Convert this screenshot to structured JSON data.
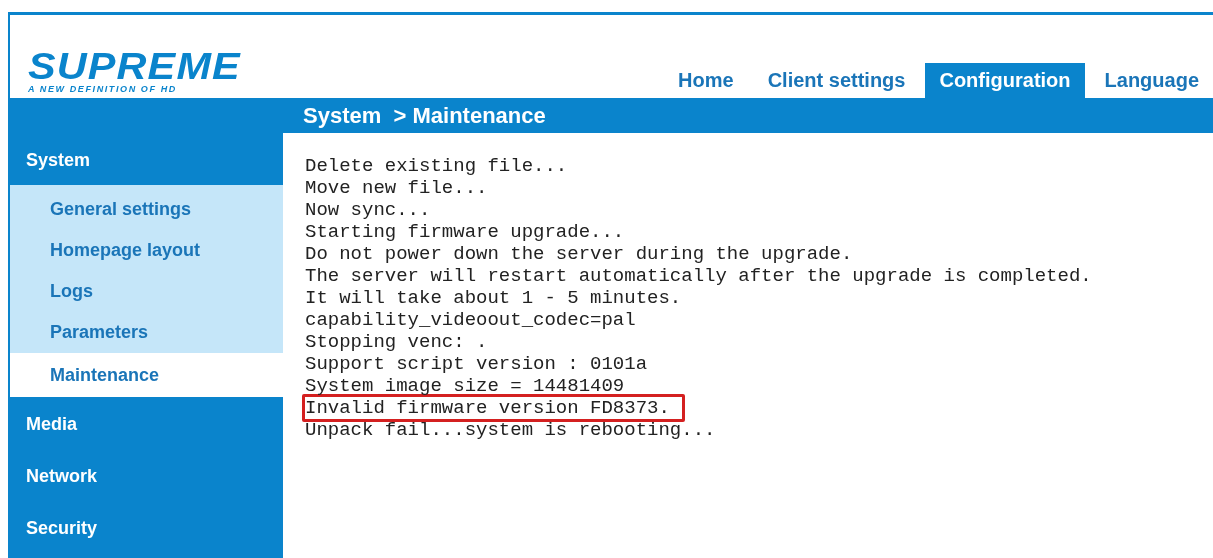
{
  "logo": {
    "name": "SUPREME",
    "tagline": "A NEW DEFINITION OF HD"
  },
  "tabs": [
    {
      "label": "Home",
      "selected": false
    },
    {
      "label": "Client settings",
      "selected": false
    },
    {
      "label": "Configuration",
      "selected": true
    },
    {
      "label": "Language",
      "selected": false
    }
  ],
  "page_title": "System  > Maintenance",
  "sidebar": {
    "items": [
      {
        "label": "System",
        "expanded": true,
        "selected": false,
        "children": [
          {
            "label": "General settings",
            "selected": false
          },
          {
            "label": "Homepage layout",
            "selected": false
          },
          {
            "label": "Logs",
            "selected": false
          },
          {
            "label": "Parameters",
            "selected": false
          },
          {
            "label": "Maintenance",
            "selected": true
          }
        ]
      },
      {
        "label": "Media",
        "selected": false
      },
      {
        "label": "Network",
        "selected": false
      },
      {
        "label": "Security",
        "selected": false
      }
    ]
  },
  "log": [
    {
      "text": "Delete existing file...",
      "highlighted": false
    },
    {
      "text": "Move new file...",
      "highlighted": false
    },
    {
      "text": "Now sync...",
      "highlighted": false
    },
    {
      "text": "Starting firmware upgrade...",
      "highlighted": false
    },
    {
      "text": "Do not power down the server during the upgrade.",
      "highlighted": false
    },
    {
      "text": "The server will restart automatically after the upgrade is completed.",
      "highlighted": false
    },
    {
      "text": "It will take about 1 - 5 minutes.",
      "highlighted": false
    },
    {
      "text": "capability_videoout_codec=pal",
      "highlighted": false
    },
    {
      "text": "Stopping venc: .",
      "highlighted": false
    },
    {
      "text": "Support script version : 0101a",
      "highlighted": false
    },
    {
      "text": "System image size = 14481409",
      "highlighted": false
    },
    {
      "text": "Invalid firmware version FD8373.",
      "highlighted": true
    },
    {
      "text": "Unpack fail...system is rebooting...",
      "highlighted": false
    }
  ]
}
